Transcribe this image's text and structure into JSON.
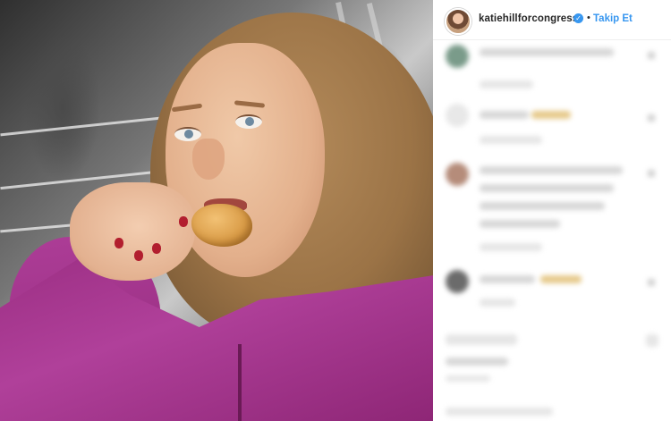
{
  "post": {
    "username": "katiehillforcongress",
    "verified_icon": "verified-badge-icon",
    "separator": "•",
    "follow_label": "Takip Et"
  },
  "colors": {
    "link_blue": "#3897f0",
    "text_dark": "#262626",
    "divider": "#efefef"
  },
  "comments": {
    "state": "blurred"
  }
}
